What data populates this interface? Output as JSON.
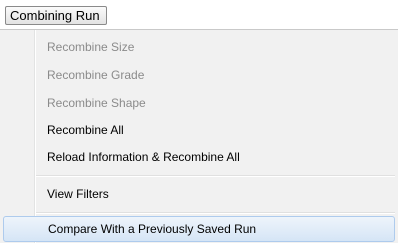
{
  "menubar": {
    "title": "Combining Run"
  },
  "menu": {
    "items": [
      {
        "label": "Recombine Size",
        "enabled": false
      },
      {
        "label": "Recombine Grade",
        "enabled": false
      },
      {
        "label": "Recombine Shape",
        "enabled": false
      },
      {
        "label": "Recombine All",
        "enabled": true
      },
      {
        "label": "Reload Information & Recombine All",
        "enabled": true
      },
      {
        "label": "View Filters",
        "enabled": true
      },
      {
        "label": "Compare With a Previously Saved Run",
        "enabled": true,
        "highlighted": true
      }
    ]
  },
  "colors": {
    "menu_background": "#f1f1f1",
    "disabled_text": "#8b8b8b",
    "highlight_border": "#aecbed",
    "highlight_fill": "#d5e5f6"
  }
}
